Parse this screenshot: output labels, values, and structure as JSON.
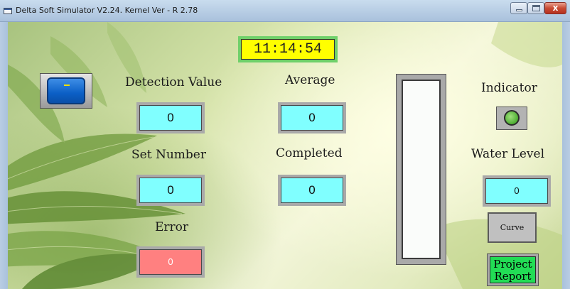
{
  "window": {
    "title": "Delta Soft Simulator V2.24. Kernel Ver - R 2.78",
    "close_glyph": "x"
  },
  "clock": {
    "time": "11:14:54"
  },
  "labels": {
    "detection_value": "Detection Value",
    "average": "Average",
    "set_number": "Set Number",
    "completed": "Completed",
    "error": "Error",
    "indicator": "Indicator",
    "water_level": "Water Level"
  },
  "values": {
    "detection_value": "0",
    "average": "0",
    "set_number": "0",
    "completed": "0",
    "error": "0",
    "water_level": "0"
  },
  "level_bar": {
    "fill_fraction": 0
  },
  "buttons": {
    "curve": "Curve",
    "project_report_line1": "Project",
    "project_report_line2": "Report"
  },
  "colors": {
    "value_box": "#80ffff",
    "error_box": "#ff8080",
    "clock_bg": "#ffff00",
    "indicator_lamp": "#4eae33",
    "report_button": "#22dd55"
  },
  "icons": {
    "app": "window-app-icon",
    "minimize": "minimize-icon",
    "maximize": "maximize-icon",
    "close": "close-icon"
  }
}
